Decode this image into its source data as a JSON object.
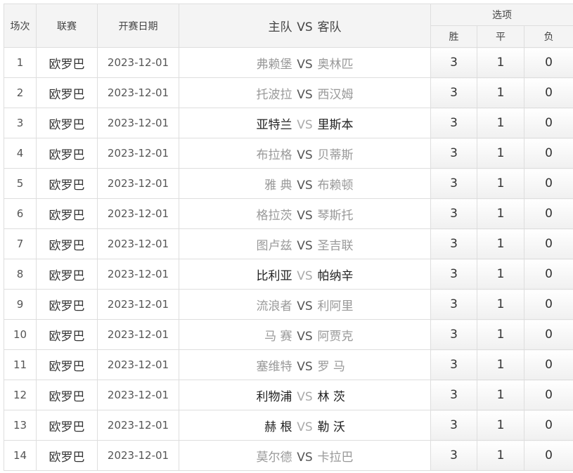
{
  "header": {
    "col_index": "场次",
    "col_league": "联赛",
    "col_date": "开赛日期",
    "col_match_home": "主队",
    "col_match_vs": "VS",
    "col_match_away": "客队",
    "col_options": "选项",
    "opt_win": "胜",
    "opt_draw": "平",
    "opt_lose": "负"
  },
  "rows": [
    {
      "idx": "1",
      "league": "欧罗巴",
      "date": "2023-12-01",
      "home": "弗赖堡",
      "away": "奥林匹",
      "emphasis": false,
      "win": "3",
      "draw": "1",
      "lose": "0"
    },
    {
      "idx": "2",
      "league": "欧罗巴",
      "date": "2023-12-01",
      "home": "托波拉",
      "away": "西汉姆",
      "emphasis": false,
      "win": "3",
      "draw": "1",
      "lose": "0"
    },
    {
      "idx": "3",
      "league": "欧罗巴",
      "date": "2023-12-01",
      "home": "亚特兰",
      "away": "里斯本",
      "emphasis": true,
      "win": "3",
      "draw": "1",
      "lose": "0"
    },
    {
      "idx": "4",
      "league": "欧罗巴",
      "date": "2023-12-01",
      "home": "布拉格",
      "away": "贝蒂斯",
      "emphasis": false,
      "win": "3",
      "draw": "1",
      "lose": "0"
    },
    {
      "idx": "5",
      "league": "欧罗巴",
      "date": "2023-12-01",
      "home": "雅 典",
      "away": "布赖顿",
      "emphasis": false,
      "win": "3",
      "draw": "1",
      "lose": "0"
    },
    {
      "idx": "6",
      "league": "欧罗巴",
      "date": "2023-12-01",
      "home": "格拉茨",
      "away": "琴斯托",
      "emphasis": false,
      "win": "3",
      "draw": "1",
      "lose": "0"
    },
    {
      "idx": "7",
      "league": "欧罗巴",
      "date": "2023-12-01",
      "home": "图卢兹",
      "away": "圣吉联",
      "emphasis": false,
      "win": "3",
      "draw": "1",
      "lose": "0"
    },
    {
      "idx": "8",
      "league": "欧罗巴",
      "date": "2023-12-01",
      "home": "比利亚",
      "away": "帕纳辛",
      "emphasis": true,
      "win": "3",
      "draw": "1",
      "lose": "0"
    },
    {
      "idx": "9",
      "league": "欧罗巴",
      "date": "2023-12-01",
      "home": "流浪者",
      "away": "利阿里",
      "emphasis": false,
      "win": "3",
      "draw": "1",
      "lose": "0"
    },
    {
      "idx": "10",
      "league": "欧罗巴",
      "date": "2023-12-01",
      "home": "马 赛",
      "away": "阿贾克",
      "emphasis": false,
      "win": "3",
      "draw": "1",
      "lose": "0"
    },
    {
      "idx": "11",
      "league": "欧罗巴",
      "date": "2023-12-01",
      "home": "塞维特",
      "away": "罗 马",
      "emphasis": false,
      "win": "3",
      "draw": "1",
      "lose": "0"
    },
    {
      "idx": "12",
      "league": "欧罗巴",
      "date": "2023-12-01",
      "home": "利物浦",
      "away": "林 茨",
      "emphasis": true,
      "win": "3",
      "draw": "1",
      "lose": "0"
    },
    {
      "idx": "13",
      "league": "欧罗巴",
      "date": "2023-12-01",
      "home": "赫 根",
      "away": "勒 沃",
      "emphasis": true,
      "win": "3",
      "draw": "1",
      "lose": "0"
    },
    {
      "idx": "14",
      "league": "欧罗巴",
      "date": "2023-12-01",
      "home": "莫尔德",
      "away": "卡拉巴",
      "emphasis": false,
      "win": "3",
      "draw": "1",
      "lose": "0"
    }
  ]
}
